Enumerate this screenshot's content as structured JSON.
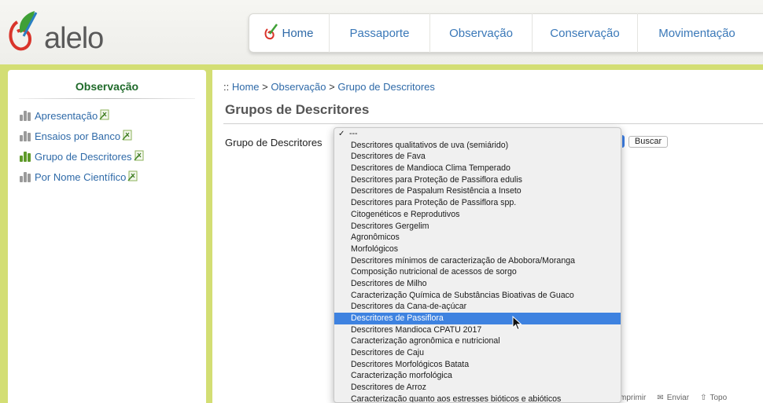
{
  "app": {
    "logo_text": "alelo"
  },
  "nav": {
    "items": [
      "Home",
      "Passaporte",
      "Observação",
      "Conservação",
      "Movimentação"
    ]
  },
  "sidebar": {
    "title": "Observação",
    "items": [
      {
        "label": "Apresentação",
        "active": false
      },
      {
        "label": "Ensaios por Banco",
        "active": false
      },
      {
        "label": "Grupo de Descritores",
        "active": true
      },
      {
        "label": "Por Nome Científico",
        "active": false
      }
    ]
  },
  "breadcrumb": {
    "prefix": "::",
    "home": "Home",
    "sep": ">",
    "section": "Observação",
    "current": "Grupo de Descritores"
  },
  "page": {
    "title": "Grupos de Descritores"
  },
  "form": {
    "label": "Grupo de Descritores",
    "buscar": "Buscar"
  },
  "dropdown": {
    "selected_index": 17,
    "options": [
      "---",
      "Descritores qualitativos de uva (semiárido)",
      "Descritores de Fava",
      "Descritores de Mandioca Clima Temperado",
      "Descritores para Proteção de Passiflora edulis",
      "Descritores de Paspalum Resistência a Inseto",
      "Descritores para Proteção de Passiflora spp.",
      "Citogenéticos e Reprodutivos",
      "Descritores Gergelim",
      "Agronômicos",
      "Morfológicos",
      "Descritores mínimos de caracterização de Abobora/Moranga",
      "Composição nutricional de acessos de sorgo",
      "Descritores de Milho",
      "Caracterização Química de Substâncias Bioativas de Guaco",
      "Descritores da Cana-de-açúcar",
      "Descritores de Passiflora",
      "Descritores Mandioca CPATU 2017",
      "Caracterização agronômica e nutricional",
      "Descritores de Caju",
      "Descritores Morfológicos Batata",
      "Caracterização morfológica",
      "Descritores de Arroz",
      "Caracterização quanto aos estresses bióticos e abióticos"
    ]
  },
  "footer": {
    "imprimir": "mprimir",
    "enviar": "Enviar",
    "topo": "Topo"
  },
  "colors": {
    "accent": "#3e82e0",
    "link": "#2f6aa8",
    "sidebar_title": "#1f6a2a",
    "background": "#c2cf64"
  }
}
